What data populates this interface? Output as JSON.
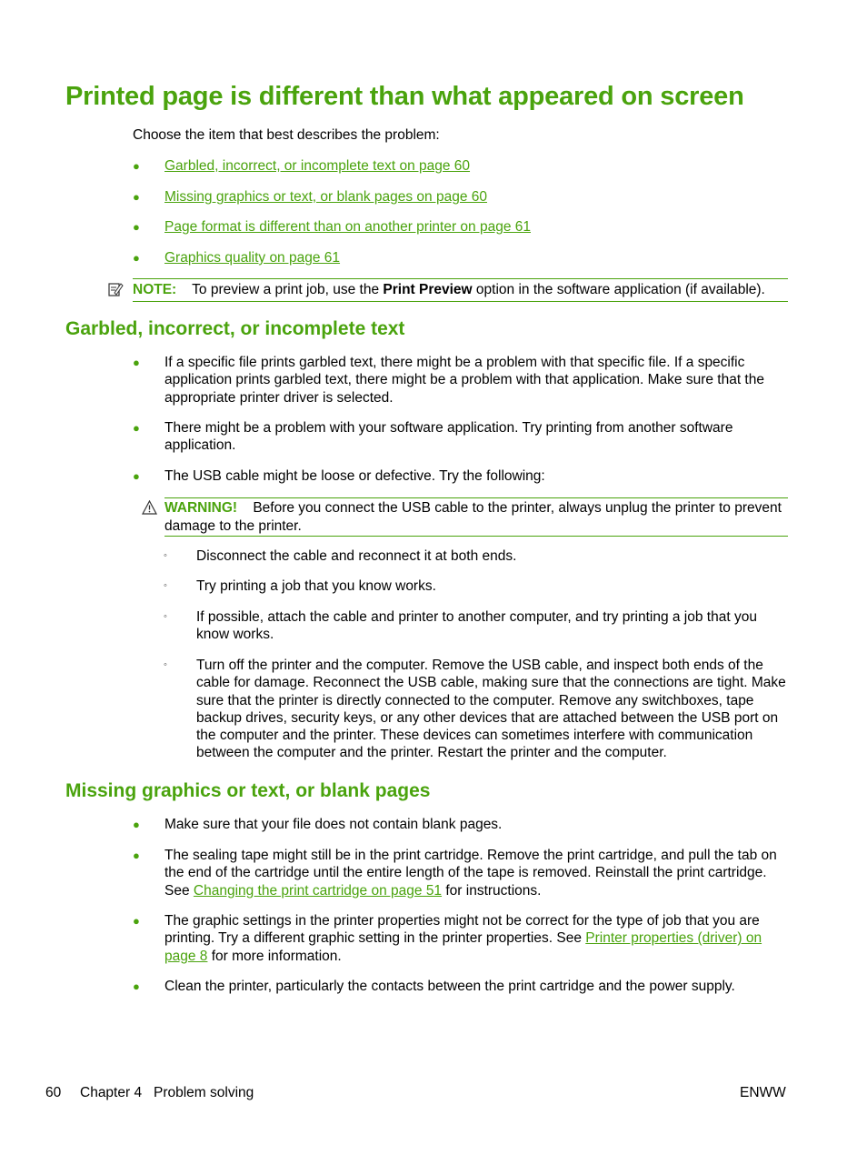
{
  "title": "Printed page is different than what appeared on screen",
  "intro": "Choose the item that best describes the problem:",
  "links": [
    "Garbled, incorrect, or incomplete text on page 60",
    "Missing graphics or text, or blank pages on page 60",
    "Page format is different than on another printer on page 61",
    "Graphics quality on page 61"
  ],
  "note": {
    "icon": "note-icon",
    "label": "NOTE:",
    "text_before": "To preview a print job, use the ",
    "bold": "Print Preview",
    "text_after": " option in the software application (if available)."
  },
  "section1": {
    "heading": "Garbled, incorrect, or incomplete text",
    "bullets": [
      "If a specific file prints garbled text, there might be a problem with that specific file. If a specific application prints garbled text, there might be a problem with that application. Make sure that the appropriate printer driver is selected.",
      "There might be a problem with your software application. Try printing from another software application.",
      "The USB cable might be loose or defective. Try the following:"
    ],
    "warning": {
      "icon": "warning-icon",
      "label": "WARNING!",
      "text": "Before you connect the USB cable to the printer, always unplug the printer to prevent damage to the printer."
    },
    "sub_bullets": [
      "Disconnect the cable and reconnect it at both ends.",
      "Try printing a job that you know works.",
      "If possible, attach the cable and printer to another computer, and try printing a job that you know works.",
      "Turn off the printer and the computer. Remove the USB cable, and inspect both ends of the cable for damage. Reconnect the USB cable, making sure that the connections are tight. Make sure that the printer is directly connected to the computer. Remove any switchboxes, tape backup drives, security keys, or any other devices that are attached between the USB port on the computer and the printer. These devices can sometimes interfere with communication between the computer and the printer. Restart the printer and the computer."
    ]
  },
  "section2": {
    "heading": "Missing graphics or text, or blank pages",
    "b1": "Make sure that your file does not contain blank pages.",
    "b2_before": "The sealing tape might still be in the print cartridge. Remove the print cartridge, and pull the tab on the end of the cartridge until the entire length of the tape is removed. Reinstall the print cartridge. See ",
    "b2_link": "Changing the print cartridge on page 51",
    "b2_after": " for instructions.",
    "b3_before": "The graphic settings in the printer properties might not be correct for the type of job that you are printing. Try a different graphic setting in the printer properties. See ",
    "b3_link": "Printer properties (driver) on page 8",
    "b3_after": " for more information.",
    "b4": "Clean the printer, particularly the contacts between the print cartridge and the power supply."
  },
  "footer": {
    "page_number": "60",
    "chapter": "Chapter 4   Problem solving",
    "right": "ENWW"
  },
  "colors": {
    "accent": "#4aa30d",
    "text": "#000000"
  }
}
